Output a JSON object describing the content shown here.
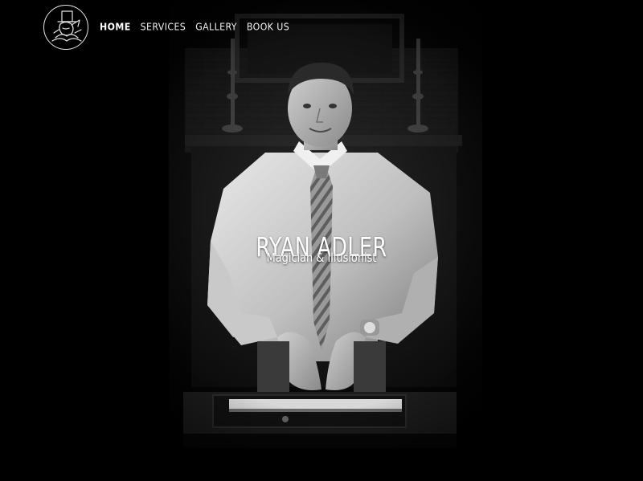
{
  "nav": {
    "items": [
      {
        "label": "HOME",
        "active": true
      },
      {
        "label": "SERVICES",
        "active": false
      },
      {
        "label": "GALLERY",
        "active": false
      },
      {
        "label": "BOOK US",
        "active": false
      }
    ]
  },
  "hero": {
    "title": "RYAN ADLER",
    "subtitle": "Magician & Illusionist"
  },
  "colors": {
    "background": "#000000",
    "nav_text": "#f2f2f2",
    "hero_text": "#ffffff"
  },
  "icons": {
    "logo": "magician-top-hat-logo-icon"
  }
}
